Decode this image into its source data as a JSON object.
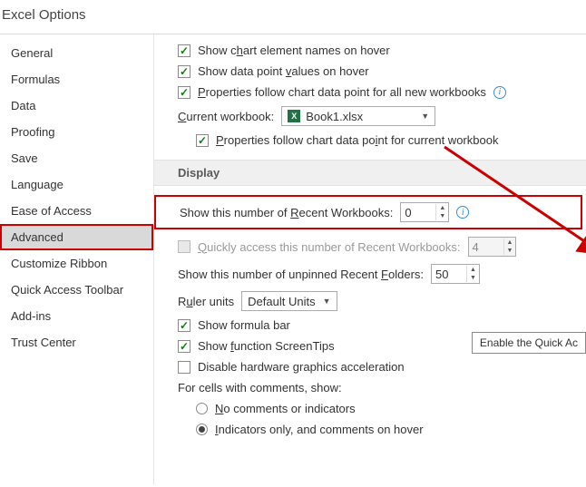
{
  "title": "Excel Options",
  "sidebar": {
    "items": [
      {
        "label": "General"
      },
      {
        "label": "Formulas"
      },
      {
        "label": "Data"
      },
      {
        "label": "Proofing"
      },
      {
        "label": "Save"
      },
      {
        "label": "Language"
      },
      {
        "label": "Ease of Access"
      },
      {
        "label": "Advanced",
        "selected": true
      },
      {
        "label": "Customize Ribbon"
      },
      {
        "label": "Quick Access Toolbar"
      },
      {
        "label": "Add-ins"
      },
      {
        "label": "Trust Center"
      }
    ]
  },
  "top": {
    "chart_names": "Show chart element names on hover",
    "data_points": "Show data point values on hover",
    "props_all": "Properties follow chart data point for all new workbooks",
    "current_wb_label": "Current workbook:",
    "current_wb_value": "Book1.xlsx",
    "props_current": "Properties follow chart data point for current workbook"
  },
  "display": {
    "header": "Display",
    "recent_wb_label": "Show this number of Recent Workbooks:",
    "recent_wb_value": "0",
    "quick_access_label": "Quickly access this number of Recent Workbooks:",
    "quick_access_value": "4",
    "recent_folders_label": "Show this number of unpinned Recent Folders:",
    "recent_folders_value": "50",
    "ruler_label": "Ruler units",
    "ruler_value": "Default Units",
    "formula_bar": "Show formula bar",
    "screentips": "Show function ScreenTips",
    "hw_accel": "Disable hardware graphics acceleration",
    "comments_header": "For cells with comments, show:",
    "comments_none": "No comments or indicators",
    "comments_indicators": "Indicators only, and comments on hover"
  },
  "tooltip": "Enable the Quick Ac"
}
